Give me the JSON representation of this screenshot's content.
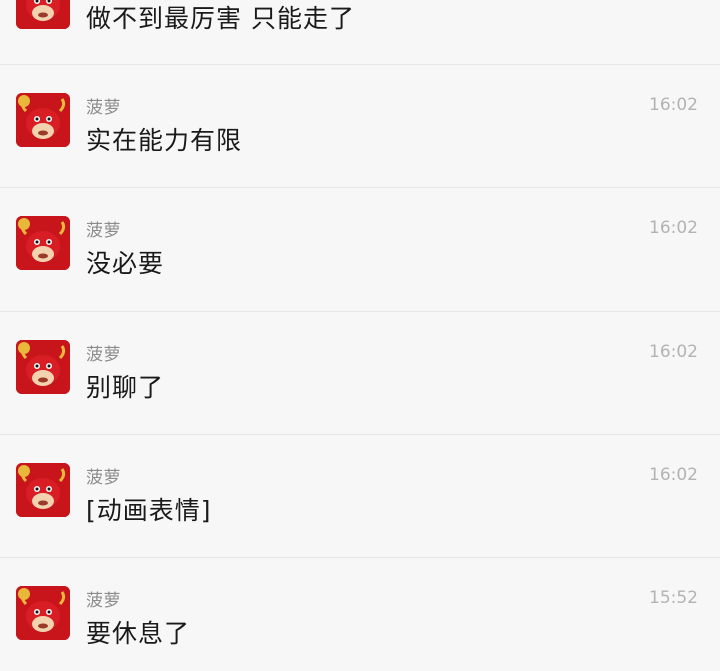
{
  "messages": [
    {
      "sender": "",
      "time": "",
      "text": "做不到最厉害 只能走了"
    },
    {
      "sender": "菠萝",
      "time": "16:02",
      "text": "实在能力有限"
    },
    {
      "sender": "菠萝",
      "time": "16:02",
      "text": "没必要"
    },
    {
      "sender": "菠萝",
      "time": "16:02",
      "text": "别聊了"
    },
    {
      "sender": "菠萝",
      "time": "16:02",
      "text": "[动画表情]"
    },
    {
      "sender": "菠萝",
      "time": "15:52",
      "text": "要休息了"
    }
  ],
  "avatar_icon": "red-cow-mascot-icon",
  "colors": {
    "background": "#f7f7f7",
    "text": "#1a1a1a",
    "sender": "#8c8c8c",
    "time": "#b3b3b3",
    "avatar_red": "#c8151c"
  }
}
